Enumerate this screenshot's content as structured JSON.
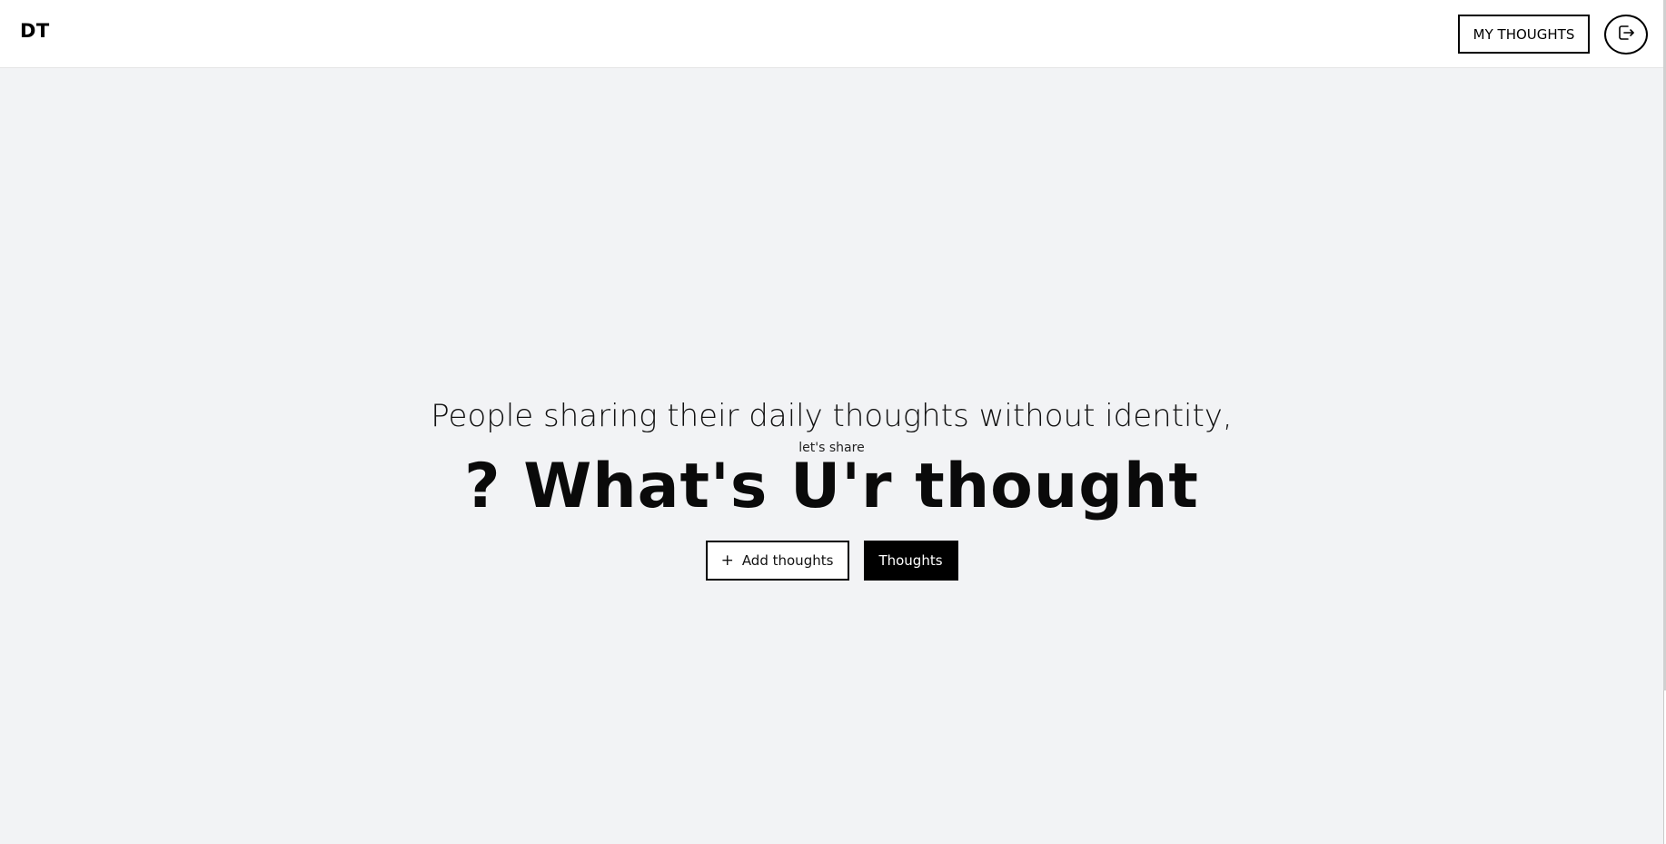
{
  "header": {
    "logo": "DT",
    "my_thoughts_label": "MY THOUGHTS",
    "logout_icon": "logout-icon"
  },
  "hero": {
    "tagline": "People sharing their daily thoughts without identity,",
    "subtag": "let's share",
    "headline": "? What's U'r thought",
    "add_button_icon": "plus-icon",
    "add_button_label": "Add thoughts",
    "thoughts_button_label": "Thoughts"
  },
  "colors": {
    "page_bg": "#f2f3f5",
    "header_bg": "#ffffff",
    "primary": "#000000"
  }
}
